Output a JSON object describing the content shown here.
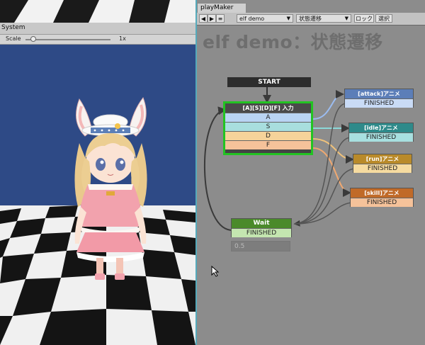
{
  "game": {
    "panel_label": "System",
    "scale_label": "Scale",
    "scale_value": "1x",
    "scale_level": 0.06
  },
  "playmaker": {
    "tab_label": "playMaker",
    "fsm_name": "elf demo",
    "state_name": "状態遷移",
    "lock_label": "ロック",
    "select_label": "選択",
    "title": "elf demo：状態遷移"
  },
  "states": {
    "start_label": "START",
    "input": {
      "title": "[A][S][D][F] 入力",
      "rows": [
        "A",
        "S",
        "D",
        "F"
      ]
    },
    "attack": {
      "title": "[attack]アニメ",
      "event": "FINISHED"
    },
    "idle": {
      "title": "[idle]アニメ",
      "event": "FINISHED"
    },
    "run": {
      "title": "[run]アニメ",
      "event": "FINISHED"
    },
    "skill": {
      "title": "[skill]アニメ",
      "event": "FINISHED"
    },
    "wait": {
      "title": "Wait",
      "event": "FINISHED",
      "param": "0.5"
    }
  },
  "colors": {
    "row_a": "#b9d4f3",
    "row_s": "#a8dede",
    "row_d": "#f6d39a",
    "row_f": "#f5c29a",
    "attack_hdr": "#5c7eb8",
    "idle_hdr": "#2e8a8a",
    "run_hdr": "#b98a2a",
    "skill_hdr": "#c06a28",
    "wait_hdr": "#4a8a2a",
    "selected": "#22c422"
  }
}
